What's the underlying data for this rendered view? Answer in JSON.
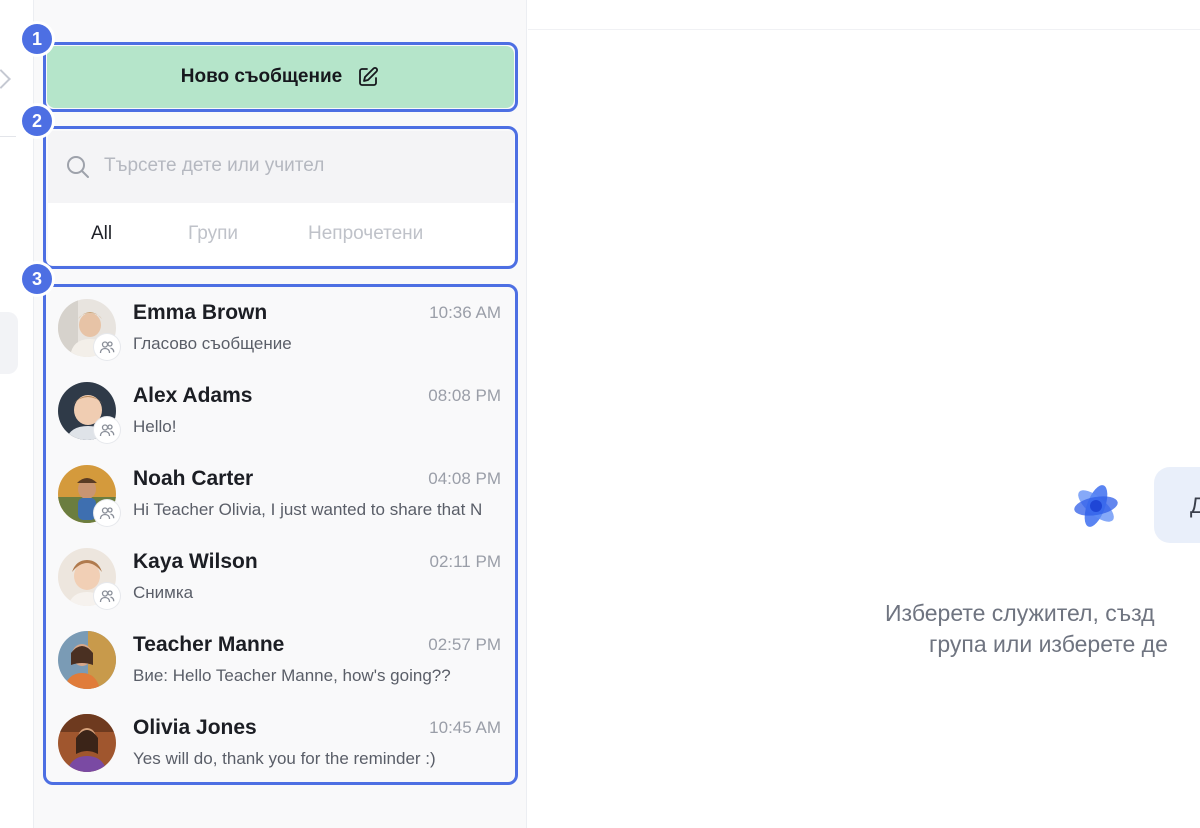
{
  "sidebar": {
    "new_message_label": "Ново съобщение",
    "search_placeholder": "Търсете дете или учител",
    "tabs": [
      {
        "label": "All",
        "active": true
      },
      {
        "label": "Групи",
        "active": false
      },
      {
        "label": "Непрочетени",
        "active": false
      }
    ],
    "conversations": [
      {
        "name": "Emma Brown",
        "time": "10:36 AM",
        "preview": "Гласово съобщение",
        "group": true
      },
      {
        "name": "Alex Adams",
        "time": "08:08 PM",
        "preview": "Hello!",
        "group": true
      },
      {
        "name": "Noah Carter",
        "time": "04:08 PM",
        "preview": "Hi Teacher Olivia, I just wanted to share that N",
        "group": true
      },
      {
        "name": "Kaya Wilson",
        "time": "02:11 PM",
        "preview": "Снимка",
        "group": true
      },
      {
        "name": "Teacher Manne",
        "time": "02:57 PM",
        "preview": "Вие: Hello Teacher Manne, how's going??",
        "group": false
      },
      {
        "name": "Olivia Jones",
        "time": "10:45 AM",
        "preview": "Yes will do, thank you for the reminder :)",
        "group": false
      }
    ]
  },
  "annotations": {
    "badges": [
      "1",
      "2",
      "3"
    ],
    "color": "#4d6fe3"
  },
  "empty_state": {
    "bubble_text": "Д",
    "line1": "Изберете служител, създ",
    "line2": "група или изберете де"
  },
  "colors": {
    "new_message_bg": "#b5e5ca",
    "accent": "#4d6fe3",
    "panel_bg": "#f9f9fa"
  }
}
